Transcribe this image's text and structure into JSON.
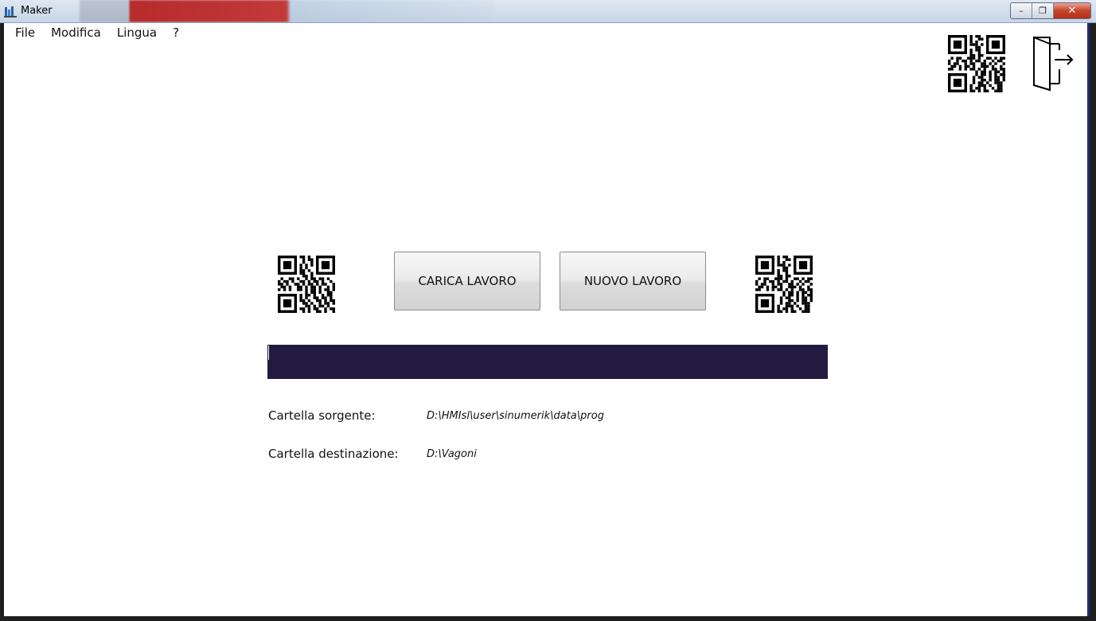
{
  "window": {
    "title": "Maker",
    "minimize_label": "–",
    "restore_label": "❐",
    "close_label": "✕"
  },
  "menu": {
    "items": [
      "File",
      "Modifica",
      "Lingua",
      "?"
    ]
  },
  "icons": {
    "top_qr": "qr-code-icon",
    "exit": "exit-door-icon",
    "left_qr": "qr-code-icon",
    "right_qr": "qr-code-icon"
  },
  "actions": {
    "load_job": "CARICA LAVORO",
    "new_job": "NUOVO LAVORO"
  },
  "scan": {
    "value": ""
  },
  "folders": {
    "source_label": "Cartella sorgente:",
    "source_path": "D:\\HMIsl\\user\\sinumerik\\data\\prog",
    "dest_label": "Cartella destinazione:",
    "dest_path": "D:\\Vagoni"
  },
  "colors": {
    "scan_bar": "#231b3f",
    "edge_accent": "#1f2d7a"
  }
}
